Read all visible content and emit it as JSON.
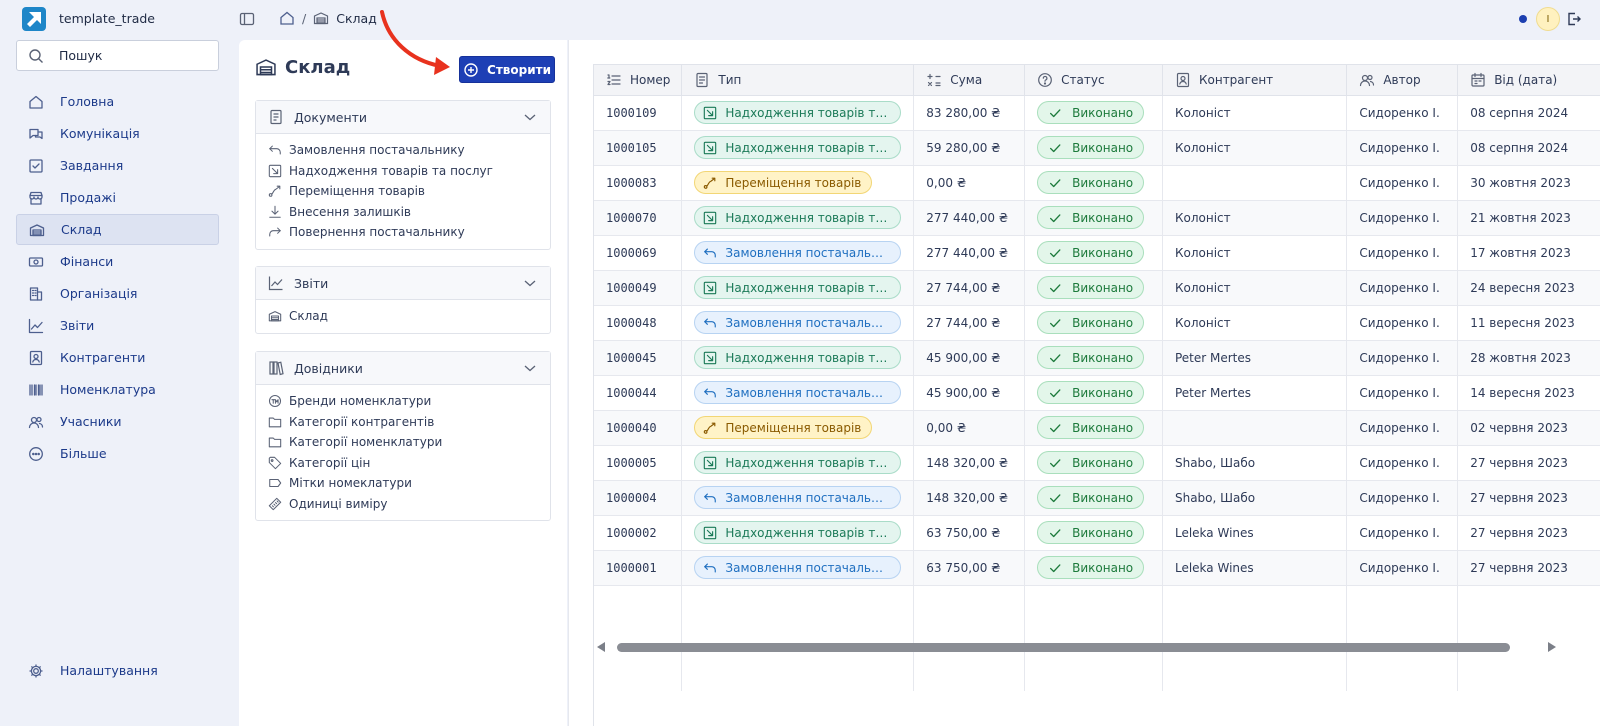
{
  "app": {
    "title": "template_trade",
    "user_initial": "I"
  },
  "breadcrumb": {
    "current": "Склад",
    "separator": "/"
  },
  "search": {
    "placeholder": "Пошук"
  },
  "nav": [
    {
      "label": "Головна",
      "icon": "home-icon",
      "active": false
    },
    {
      "label": "Комунікація",
      "icon": "chat-icon",
      "active": false
    },
    {
      "label": "Завдання",
      "icon": "tasks-icon",
      "active": false
    },
    {
      "label": "Продажі",
      "icon": "shop-icon",
      "active": false
    },
    {
      "label": "Склад",
      "icon": "warehouse-icon",
      "active": true
    },
    {
      "label": "Фінанси",
      "icon": "money-icon",
      "active": false
    },
    {
      "label": "Організація",
      "icon": "building-icon",
      "active": false
    },
    {
      "label": "Звіти",
      "icon": "chart-icon",
      "active": false
    },
    {
      "label": "Контрагенти",
      "icon": "contact-card-icon",
      "active": false
    },
    {
      "label": "Номенклатура",
      "icon": "barcode-icon",
      "active": false
    },
    {
      "label": "Учасники",
      "icon": "users-icon",
      "active": false
    },
    {
      "label": "Більше",
      "icon": "more-icon",
      "active": false
    }
  ],
  "settings": {
    "label": "Налаштування",
    "icon": "gear-icon"
  },
  "page": {
    "title": "Склад",
    "create_label": "Створити"
  },
  "cards": {
    "documents": {
      "title": "Документи",
      "items": [
        {
          "label": "Замовлення постачальнику",
          "icon": "undo-arrow-icon"
        },
        {
          "label": "Надходження товарів та послуг",
          "icon": "inbound-arrow-icon"
        },
        {
          "label": "Переміщення товарів",
          "icon": "route-icon"
        },
        {
          "label": "Внесення залишків",
          "icon": "download-icon"
        },
        {
          "label": "Повернення постачальнику",
          "icon": "redo-arrow-icon"
        }
      ]
    },
    "reports": {
      "title": "Звіти",
      "items": [
        {
          "label": "Склад",
          "icon": "warehouse-icon"
        }
      ]
    },
    "references": {
      "title": "Довідники",
      "items": [
        {
          "label": "Бренди номенклатури",
          "icon": "trademark-icon"
        },
        {
          "label": "Категорії контрагентів",
          "icon": "folder-icon"
        },
        {
          "label": "Категорії номенклатури",
          "icon": "folder-icon"
        },
        {
          "label": "Категорії цін",
          "icon": "price-tag-icon"
        },
        {
          "label": "Мітки номеклатури",
          "icon": "label-icon"
        },
        {
          "label": "Одиниці виміру",
          "icon": "ruler-icon"
        }
      ]
    }
  },
  "table": {
    "columns": [
      {
        "label": "Номер",
        "icon": "number-list-icon"
      },
      {
        "label": "Тип",
        "icon": "document-icon"
      },
      {
        "label": "Сума",
        "icon": "calculator-icon"
      },
      {
        "label": "Статус",
        "icon": "question-circle-icon"
      },
      {
        "label": "Контрагент",
        "icon": "contact-card-icon"
      },
      {
        "label": "Автор",
        "icon": "users-icon"
      },
      {
        "label": "Від (дата)",
        "icon": "calendar-icon"
      }
    ],
    "rows": [
      {
        "number": "1000109",
        "type": "Надходження товарів та по…",
        "type_kind": "receipt",
        "sum": "83 280,00 ₴",
        "status": "Виконано",
        "counterparty": "Колоніст",
        "author": "Сидоренко І.",
        "date": "08 серпня 2024"
      },
      {
        "number": "1000105",
        "type": "Надходження товарів та по…",
        "type_kind": "receipt",
        "sum": "59 280,00 ₴",
        "status": "Виконано",
        "counterparty": "Колоніст",
        "author": "Сидоренко І.",
        "date": "08 серпня 2024"
      },
      {
        "number": "1000083",
        "type": "Переміщення товарів",
        "type_kind": "move",
        "sum": "0,00 ₴",
        "status": "Виконано",
        "counterparty": "",
        "author": "Сидоренко І.",
        "date": "30 жовтня 2023"
      },
      {
        "number": "1000070",
        "type": "Надходження товарів та по…",
        "type_kind": "receipt",
        "sum": "277 440,00 ₴",
        "status": "Виконано",
        "counterparty": "Колоніст",
        "author": "Сидоренко І.",
        "date": "21 жовтня 2023"
      },
      {
        "number": "1000069",
        "type": "Замовлення постачальнику",
        "type_kind": "order",
        "sum": "277 440,00 ₴",
        "status": "Виконано",
        "counterparty": "Колоніст",
        "author": "Сидоренко І.",
        "date": "17 жовтня 2023"
      },
      {
        "number": "1000049",
        "type": "Надходження товарів та по…",
        "type_kind": "receipt",
        "sum": "27 744,00 ₴",
        "status": "Виконано",
        "counterparty": "Колоніст",
        "author": "Сидоренко І.",
        "date": "24 вересня 2023"
      },
      {
        "number": "1000048",
        "type": "Замовлення постачальнику",
        "type_kind": "order",
        "sum": "27 744,00 ₴",
        "status": "Виконано",
        "counterparty": "Колоніст",
        "author": "Сидоренко І.",
        "date": "11 вересня 2023"
      },
      {
        "number": "1000045",
        "type": "Надходження товарів та по…",
        "type_kind": "receipt",
        "sum": "45 900,00 ₴",
        "status": "Виконано",
        "counterparty": "Peter Mertes",
        "author": "Сидоренко І.",
        "date": "28 жовтня 2023"
      },
      {
        "number": "1000044",
        "type": "Замовлення постачальнику",
        "type_kind": "order",
        "sum": "45 900,00 ₴",
        "status": "Виконано",
        "counterparty": "Peter Mertes",
        "author": "Сидоренко І.",
        "date": "14 вересня 2023"
      },
      {
        "number": "1000040",
        "type": "Переміщення товарів",
        "type_kind": "move",
        "sum": "0,00 ₴",
        "status": "Виконано",
        "counterparty": "",
        "author": "Сидоренко І.",
        "date": "02 червня 2023"
      },
      {
        "number": "1000005",
        "type": "Надходження товарів та по…",
        "type_kind": "receipt",
        "sum": "148 320,00 ₴",
        "status": "Виконано",
        "counterparty": "Shabo, Шабо",
        "author": "Сидоренко І.",
        "date": "27 червня 2023"
      },
      {
        "number": "1000004",
        "type": "Замовлення постачальнику",
        "type_kind": "order",
        "sum": "148 320,00 ₴",
        "status": "Виконано",
        "counterparty": "Shabo, Шабо",
        "author": "Сидоренко І.",
        "date": "27 червня 2023"
      },
      {
        "number": "1000002",
        "type": "Надходження товарів та по…",
        "type_kind": "receipt",
        "sum": "63 750,00 ₴",
        "status": "Виконано",
        "counterparty": "Leleka Wines",
        "author": "Сидоренко І.",
        "date": "27 червня 2023"
      },
      {
        "number": "1000001",
        "type": "Замовлення постачальнику",
        "type_kind": "order",
        "sum": "63 750,00 ₴",
        "status": "Виконано",
        "counterparty": "Leleka Wines",
        "author": "Сидоренко І.",
        "date": "27 червня 2023"
      }
    ]
  },
  "colors": {
    "accent": "#1d3fb5",
    "annotation_arrow": "#e8321e",
    "receipt": "#1b7a58",
    "order": "#1f6fc0",
    "move": "#8a5a00",
    "status_done": "#1d7a3c"
  }
}
